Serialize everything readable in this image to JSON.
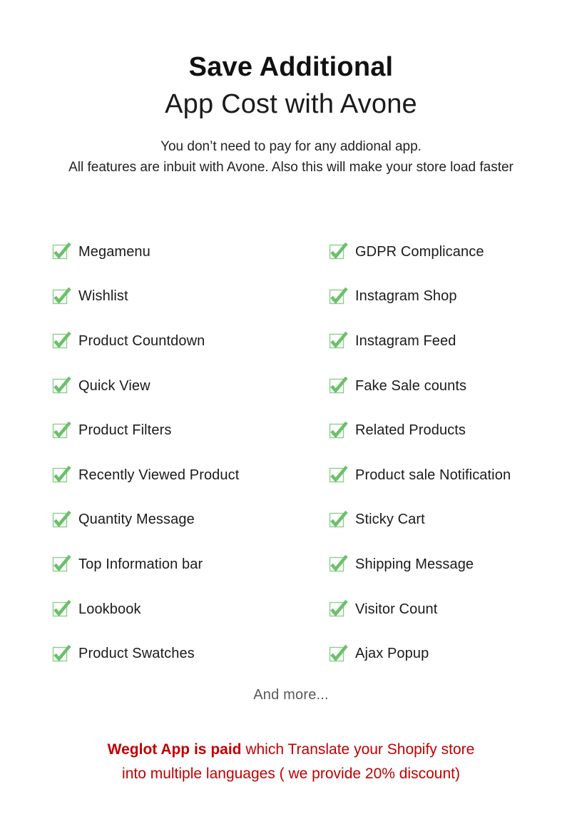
{
  "heading": {
    "line1": "Save Additional",
    "line2": "App Cost with Avone"
  },
  "subtitle": {
    "line1": "You don’t need to pay for any addional app.",
    "line2": "All features are inbuit with Avone. Also this will make your store load faster"
  },
  "features": {
    "icon_name": "green-checkmark-icon",
    "left_column": [
      {
        "label": "Megamenu"
      },
      {
        "label": "Wishlist"
      },
      {
        "label": "Product Countdown"
      },
      {
        "label": "Quick View"
      },
      {
        "label": "Product Filters"
      },
      {
        "label": "Recently Viewed Product"
      },
      {
        "label": "Quantity Message"
      },
      {
        "label": "Top Information bar"
      },
      {
        "label": "Lookbook"
      },
      {
        "label": "Product Swatches"
      }
    ],
    "right_column": [
      {
        "label": "GDPR Complicance"
      },
      {
        "label": "Instagram Shop"
      },
      {
        "label": "Instagram Feed"
      },
      {
        "label": "Fake Sale counts"
      },
      {
        "label": "Related Products"
      },
      {
        "label": "Product sale Notification"
      },
      {
        "label": "Sticky Cart"
      },
      {
        "label": "Shipping Message"
      },
      {
        "label": "Visitor Count"
      },
      {
        "label": "Ajax Popup"
      }
    ]
  },
  "and_more": "And more...",
  "footer": {
    "line1_strong": "Weglot App is paid",
    "line1_rest": " which Translate your Shopify store",
    "line2": "into multiple languages ( we provide 20% discount)"
  },
  "colors": {
    "check_green": "#6CC06B",
    "check_box_border": "#8ACF89",
    "footer_red": "#C00000",
    "heading_black": "#111111",
    "and_more_grey": "#595959",
    "background": "#FFFFFF"
  }
}
